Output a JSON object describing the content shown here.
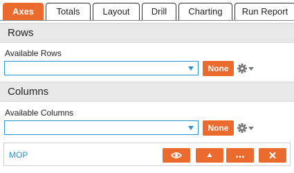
{
  "tabs": [
    {
      "label": "Axes",
      "active": true
    },
    {
      "label": "Totals",
      "active": false
    },
    {
      "label": "Layout",
      "active": false
    },
    {
      "label": "Drill",
      "active": false
    },
    {
      "label": "Charting",
      "active": false
    },
    {
      "label": "Run Report",
      "active": false
    }
  ],
  "rows_section": {
    "title": "Rows",
    "field_label": "Available Rows",
    "select_value": "",
    "none_label": "None"
  },
  "columns_section": {
    "title": "Columns",
    "field_label": "Available Columns",
    "select_value": "",
    "none_label": "None"
  },
  "bottom_bar": {
    "link_label": "MOP",
    "actions": [
      "eye-icon",
      "up-arrow-icon",
      "ellipsis-icon",
      "close-icon"
    ]
  },
  "colors": {
    "accent": "#ea6b2d",
    "link": "#2b93d0",
    "section_bg": "#e8e8e8"
  }
}
